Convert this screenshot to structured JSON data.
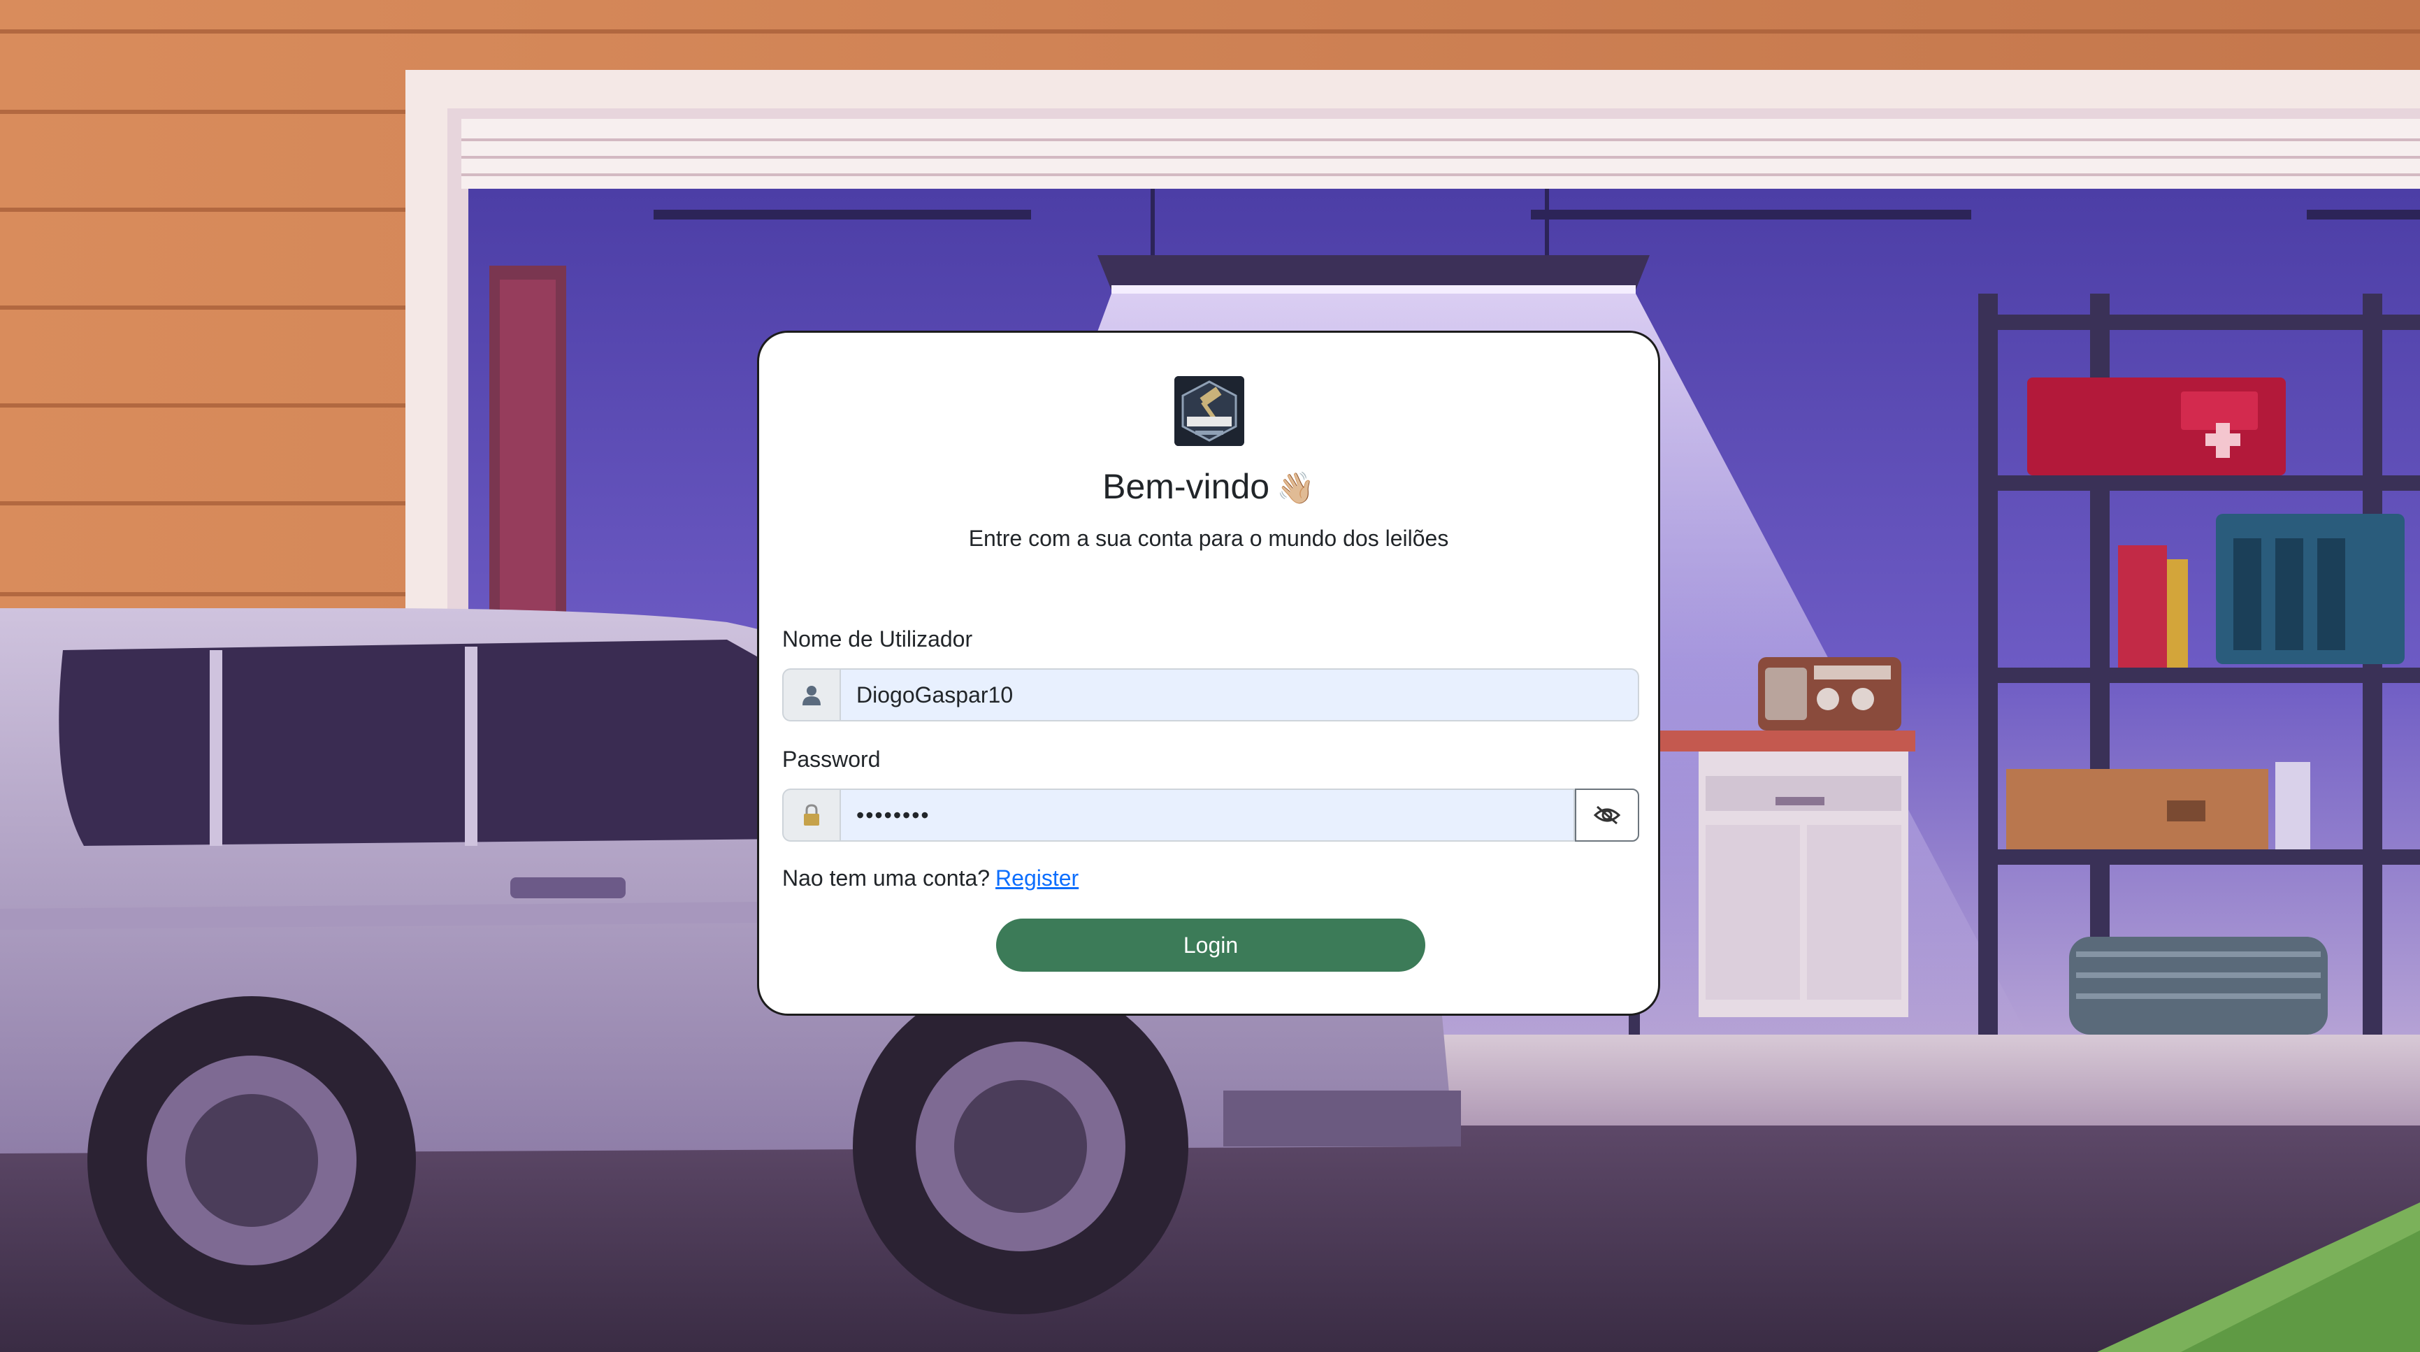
{
  "background": {
    "name": "garage-illustration"
  },
  "login": {
    "title": "Bem-vindo",
    "title_emoji": "👋🏼",
    "subtitle": "Entre com a sua conta para o mundo dos leilões",
    "username_label": "Nome de Utilizador",
    "username_value": "DiogoGaspar10",
    "password_label": "Password",
    "password_value": "••••••••",
    "register_prompt": "Nao tem uma conta?",
    "register_link": "Register",
    "login_button": "Login"
  },
  "icons": {
    "user": "user-icon",
    "lock": "lock-icon",
    "eye": "eye-slash-icon"
  },
  "colors": {
    "primary_green": "#3c7b58",
    "link_blue": "#0d6efd",
    "input_fill": "#e8f0fe"
  }
}
